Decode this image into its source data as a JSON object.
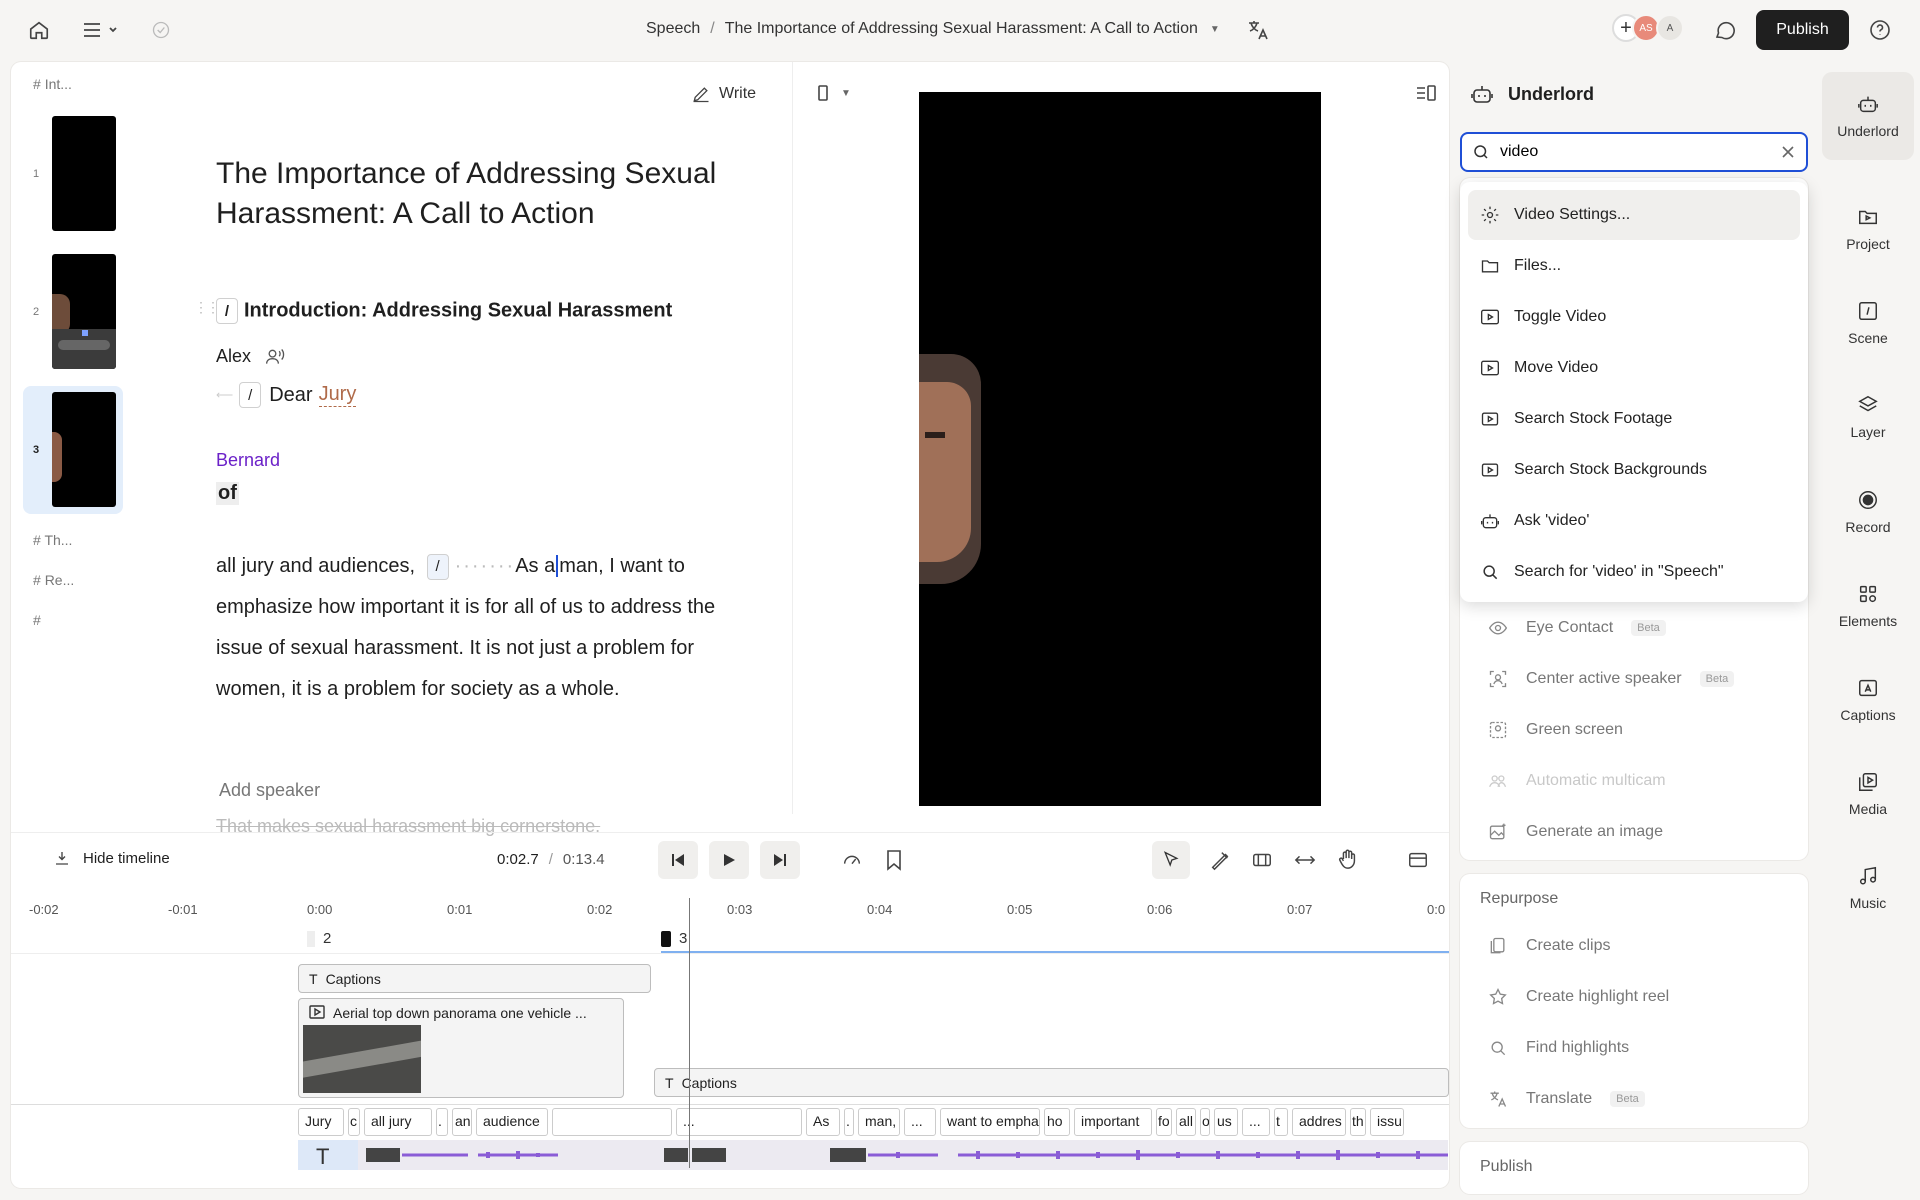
{
  "breadcrumb": {
    "project": "Speech",
    "doc": "The Importance of Addressing Sexual Harassment: A Call to Action"
  },
  "header": {
    "publish_label": "Publish",
    "avatar1": "AS",
    "avatar2": "A"
  },
  "scenes": {
    "top_heading": "Int...",
    "numbers": [
      "1",
      "2",
      "3"
    ],
    "headings": [
      "Th...",
      "Re..."
    ]
  },
  "doc": {
    "title": "The Importance of Addressing Sexual Harassment: A Call to Action",
    "section_heading": "Introduction: Addressing Sexual Harassment",
    "speaker1": "Alex",
    "line1_a": "Dear",
    "line1_b": "Jury",
    "speaker2": "Bernard",
    "word_of": "of",
    "para_a": "all jury and audiences,",
    "para_b": "As a",
    "para_c": "man, I want to emphasize how important it is for all of us to address the issue of sexual harassment.",
    "para_d": "It is not just a problem for women, it is a problem for society as a whole.",
    "add_speaker": "Add speaker",
    "faded_text": "That makes sexual harassment big cornerstone."
  },
  "write_label": "Write",
  "timeline": {
    "hide_label": "Hide timeline",
    "current": "0:02.7",
    "sep": "/",
    "total": "0:13.4",
    "ticks": [
      "-0:02",
      "-0:01",
      "0:00",
      "0:01",
      "0:02",
      "0:03",
      "0:04",
      "0:05",
      "0:06",
      "0:07",
      "0:0"
    ],
    "scene_markers": [
      "2",
      "3"
    ],
    "captions_label": "Captions",
    "clip_label": "Aerial top down panorama one vehicle ...",
    "words": [
      "Jury",
      "c",
      "all jury",
      ".",
      "an",
      "audience",
      "",
      "...",
      "As",
      ".",
      "man,",
      "...",
      "want to empha",
      "ho",
      "important",
      "fo",
      "all",
      "o",
      "us",
      "...",
      "t",
      "addres",
      "th",
      "issu"
    ]
  },
  "underlord": {
    "title": "Underlord",
    "search_value": "video",
    "dropdown": [
      "Video Settings...",
      "Files...",
      "Toggle Video",
      "Move Video",
      "Search Stock Footage",
      "Search Stock Backgrounds",
      "Ask 'video'",
      "Search for 'video' in \"Speech\""
    ],
    "ai_items": [
      {
        "label": "Eye Contact",
        "beta": "Beta"
      },
      {
        "label": "Center active speaker",
        "beta": "Beta"
      },
      {
        "label": "Green screen",
        "beta": ""
      },
      {
        "label": "Automatic multicam",
        "beta": ""
      },
      {
        "label": "Generate an image",
        "beta": ""
      }
    ],
    "repurpose_header": "Repurpose",
    "repurpose_items": [
      {
        "label": "Create clips",
        "beta": ""
      },
      {
        "label": "Create highlight reel",
        "beta": ""
      },
      {
        "label": "Find highlights",
        "beta": ""
      },
      {
        "label": "Translate",
        "beta": "Beta"
      }
    ],
    "publish_header": "Publish"
  },
  "side_tabs": [
    "Underlord",
    "Project",
    "Scene",
    "Layer",
    "Record",
    "Elements",
    "Captions",
    "Media",
    "Music"
  ]
}
